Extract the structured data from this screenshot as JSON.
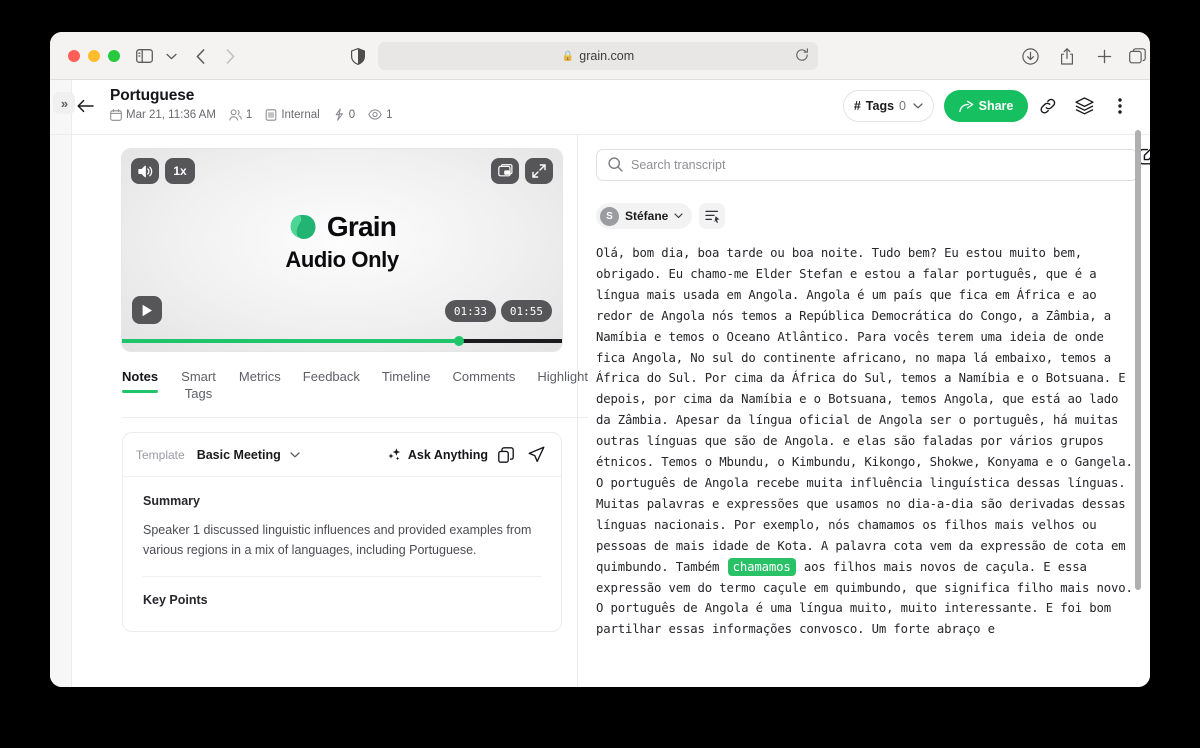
{
  "browser": {
    "url": "grain.com",
    "lock_glyph": "🔒",
    "icons": {
      "sidebar": "sidebar-icon",
      "sidebar_chevron": "chevron-down-icon",
      "back": "back-arrow-icon",
      "forward": "forward-arrow-icon",
      "shield": "privacy-shield-icon",
      "reload": "reload-icon",
      "download": "download-icon",
      "share": "share-icon",
      "new_tab": "plus-icon",
      "tab_overview": "tab-overview-icon"
    }
  },
  "app_header": {
    "expand_label": "»",
    "back_label": "←",
    "title": "Portuguese",
    "meta": {
      "date": "Mar 21, 11:36 AM",
      "participants": "1",
      "visibility": "Internal",
      "reactions": "0",
      "views": "1"
    },
    "tags_label": "Tags",
    "tags_count": "0",
    "tags_hash": "#",
    "share_label": "Share",
    "accent_green": "#16c060"
  },
  "player": {
    "volume_label": "volume",
    "speed_label": "1x",
    "pip_label": "picture-in-picture",
    "fullscreen_label": "fullscreen",
    "play_label": "play",
    "brand_name": "Grain",
    "overlay_text": "Audio Only",
    "current_time": "01:33",
    "total_time": "01:55",
    "progress_percent": 76.5,
    "progress_color": "#1fc46b"
  },
  "tabs": [
    {
      "label": "Notes",
      "active": true
    },
    {
      "label": "Smart Tags",
      "active": false
    },
    {
      "label": "Metrics",
      "active": false
    },
    {
      "label": "Feedback",
      "active": false
    },
    {
      "label": "Timeline",
      "active": false
    },
    {
      "label": "Comments",
      "active": false
    },
    {
      "label": "Highlight",
      "active": false
    }
  ],
  "notes": {
    "template_label": "Template",
    "template_value": "Basic Meeting",
    "ask_label": "Ask Anything",
    "copy_label": "copy",
    "send_label": "send",
    "summary_heading": "Summary",
    "summary_text": "Speaker 1 discussed linguistic influences and provided examples from various regions in a mix of languages, including Portuguese.",
    "key_points_heading": "Key Points"
  },
  "transcript_panel": {
    "search_placeholder": "Search transcript",
    "edit_label": "edit-transcript",
    "speaker_initial": "S",
    "speaker_name": "Stéfane",
    "filter_label": "filter-transcript",
    "highlight_color": "#29c267",
    "text_before": "Olá, bom dia, boa tarde ou boa noite. Tudo bem? Eu estou muito bem, obrigado. Eu chamo-me Elder Stefan e estou a falar português, que é a língua mais usada em Angola. Angola é um país que fica em África e ao redor de Angola nós temos a República Democrática do Congo, a Zâmbia, a Namíbia e temos o Oceano Atlântico. Para vocês terem uma ideia de onde fica Angola, No sul do continente africano, no mapa lá embaixo, temos a África do Sul. Por cima da África do Sul, temos a Namíbia e o Botsuana. E depois, por cima da Namíbia e o Botsuana, temos Angola, que está ao lado da Zâmbia. Apesar da língua oficial de Angola ser o português, há muitas outras línguas que são de Angola. e elas são faladas por vários grupos étnicos. Temos o Mbundu, o Kimbundu, Kikongo, Shokwe, Konyama e o Gangela. O português de Angola recebe muita influência linguística dessas línguas. Muitas palavras e expressões que usamos no dia-a-dia são derivadas dessas línguas nacionais. Por exemplo, nós chamamos os filhos mais velhos ou pessoas de mais idade de Kota. A palavra cota vem da expressão de cota em quimbundo. Também ",
    "highlighted_word": "chamamos",
    "text_after": " aos filhos mais novos de caçula. E essa expressão vem do termo caçule em quimbundo, que significa filho mais novo. O português de Angola é uma língua muito, muito interessante. E foi bom partilhar essas informações convosco. Um forte abraço e"
  }
}
